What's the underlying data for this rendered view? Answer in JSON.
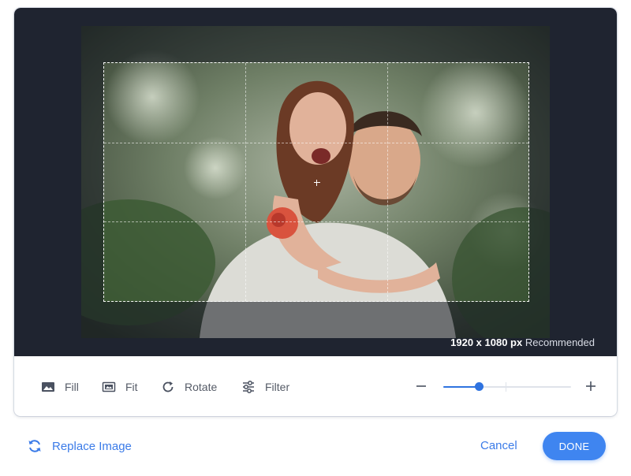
{
  "editor": {
    "resolution_text": "1920 x 1080 px",
    "recommended_text": "Recommended"
  },
  "toolbar": {
    "fill_label": "Fill",
    "fit_label": "Fit",
    "rotate_label": "Rotate",
    "filter_label": "Filter",
    "zoom_level_fraction": 0.28
  },
  "footer": {
    "replace_label": "Replace Image",
    "cancel_label": "Cancel",
    "done_label": "DONE"
  },
  "colors": {
    "accent": "#3f85f0",
    "canvas_bg": "#1f2430",
    "text_muted": "#555b67"
  },
  "icons": {
    "fill": "image-fill-icon",
    "fit": "image-fit-icon",
    "rotate": "rotate-icon",
    "filter": "sliders-icon",
    "zoom_out": "minus-icon",
    "zoom_in": "plus-icon",
    "replace": "refresh-icon"
  }
}
